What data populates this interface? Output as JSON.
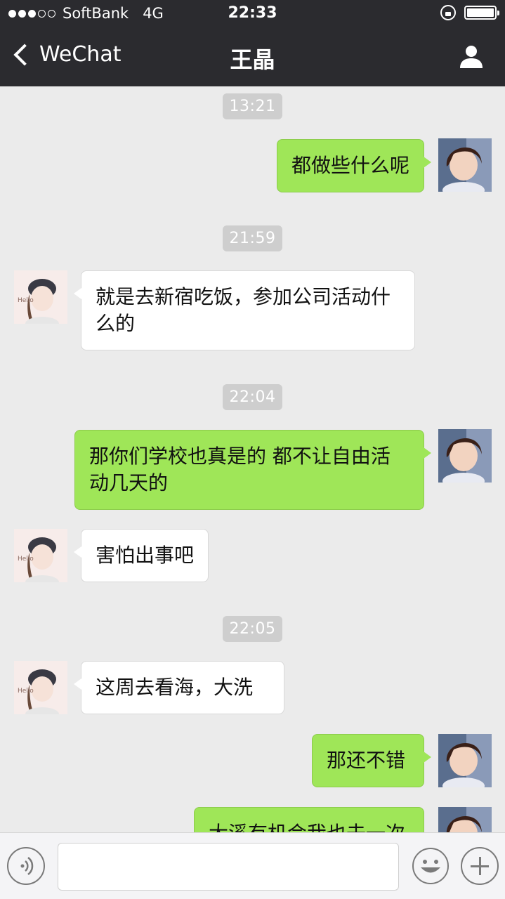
{
  "status_bar": {
    "carrier": "SoftBank",
    "network": "4G",
    "time": "22:33"
  },
  "nav": {
    "back_label": "WeChat",
    "title": "王晶"
  },
  "messages": [
    {
      "type": "timestamp",
      "text": "13:21"
    },
    {
      "type": "message",
      "from": "me",
      "text": "都做些什么呢"
    },
    {
      "type": "timestamp",
      "text": "21:59"
    },
    {
      "type": "message",
      "from": "her",
      "text": "就是去新宿吃饭，参加公司活动什么的"
    },
    {
      "type": "timestamp",
      "text": "22:04"
    },
    {
      "type": "message",
      "from": "me",
      "text": "那你们学校也真是的  都不让自由活动几天的"
    },
    {
      "type": "message",
      "from": "her",
      "text": "害怕出事吧"
    },
    {
      "type": "timestamp",
      "text": "22:05"
    },
    {
      "type": "message",
      "from": "her",
      "text": "这周去看海，大洗"
    },
    {
      "type": "message",
      "from": "me",
      "text": "那还不错"
    },
    {
      "type": "message",
      "from": "me",
      "text": "大溪有机会我也去一次"
    }
  ],
  "colors": {
    "header_bg": "#2b2b2f",
    "chat_bg": "#ebebeb",
    "my_bubble": "#9fe658",
    "her_bubble": "#ffffff"
  },
  "icons": {
    "back": "chevron-left-icon",
    "profile": "person-icon",
    "voice": "voice-icon",
    "emoji": "emoji-icon",
    "plus": "plus-icon"
  }
}
